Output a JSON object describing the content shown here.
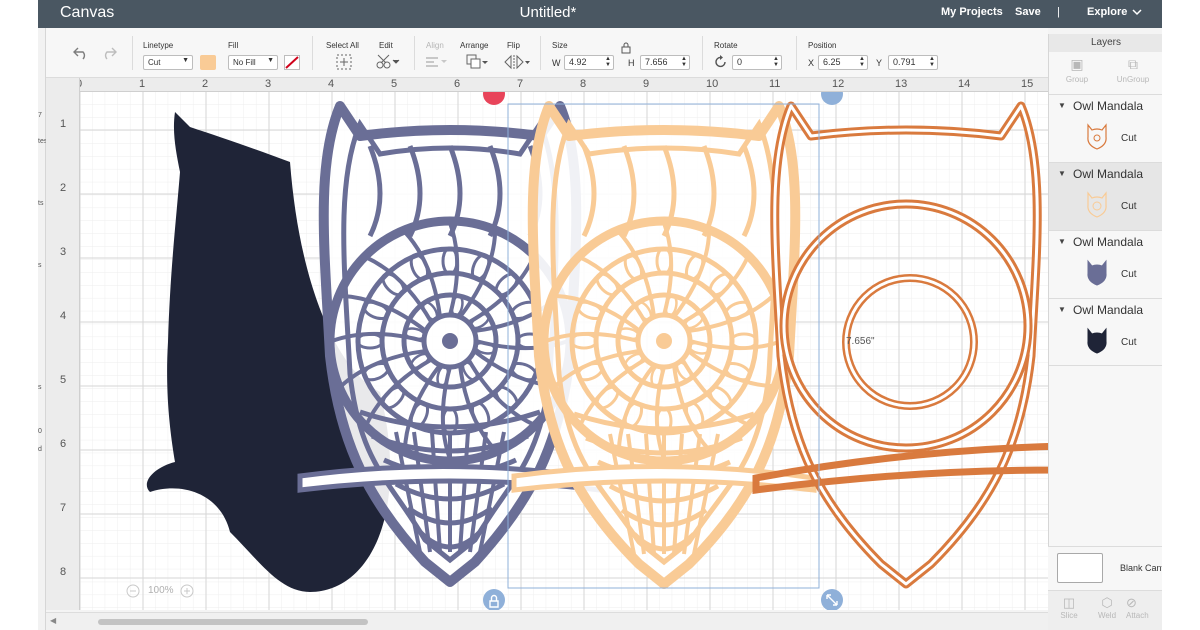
{
  "titlebar": {
    "app_name": "Canvas",
    "doc_title": "Untitled*",
    "my_projects": "My Projects",
    "save": "Save",
    "separator": "|",
    "explore": "Explore"
  },
  "leftstrip": {
    "fragments": [
      "7",
      "tes",
      "ts",
      "s",
      "s",
      "0",
      "d"
    ]
  },
  "toolbar": {
    "undo_icon": "undo-icon",
    "redo_icon": "redo-icon",
    "linetype_label": "Linetype",
    "linetype_value": "Cut",
    "linetype_color": "#f9cb96",
    "fill_label": "Fill",
    "fill_value": "No Fill",
    "select_all_label": "Select All",
    "edit_label": "Edit",
    "align_label": "Align",
    "arrange_label": "Arrange",
    "flip_label": "Flip",
    "size_label": "Size",
    "w_label": "W",
    "w_value": "4.92",
    "h_label": "H",
    "h_value": "7.656",
    "rotate_label": "Rotate",
    "rotate_value": "0",
    "position_label": "Position",
    "x_label": "X",
    "x_value": "6.25",
    "y_label": "Y",
    "y_value": "0.791"
  },
  "ruler": {
    "top_ticks": [
      "0",
      "1",
      "2",
      "3",
      "4",
      "5",
      "6",
      "7",
      "8",
      "9",
      "10",
      "11",
      "12",
      "13",
      "14",
      "15"
    ],
    "left_ticks": [
      "1",
      "2",
      "3",
      "4",
      "5",
      "6",
      "7",
      "8"
    ]
  },
  "canvas": {
    "size_readout": "7.656\"",
    "zoom_minus": "−",
    "zoom_level": "100%",
    "zoom_plus": "+",
    "owls": [
      {
        "name": "black-owl",
        "color": "#1f2437"
      },
      {
        "name": "slate-owl",
        "color": "#6a6e96"
      },
      {
        "name": "peach-owl",
        "color": "#f9cb96"
      },
      {
        "name": "orange-owl",
        "color": "#d97a3e"
      }
    ],
    "selection_color": "#8fb0d9"
  },
  "layers": {
    "header": "Layers",
    "group": "Group",
    "ungroup": "UnGroup",
    "items": [
      {
        "name": "Owl Mandala",
        "op": "Cut",
        "color": "#d97a3e",
        "active": false
      },
      {
        "name": "Owl Mandala",
        "op": "Cut",
        "color": "#f9cb96",
        "active": true
      },
      {
        "name": "Owl Mandala",
        "op": "Cut",
        "color": "#6a6e96",
        "active": false
      },
      {
        "name": "Owl Mandala",
        "op": "Cut",
        "color": "#1f2437",
        "active": false
      }
    ],
    "blank_canvas": "Blank Canvas",
    "slice": "Slice",
    "weld": "Weld",
    "attach": "Attach"
  }
}
